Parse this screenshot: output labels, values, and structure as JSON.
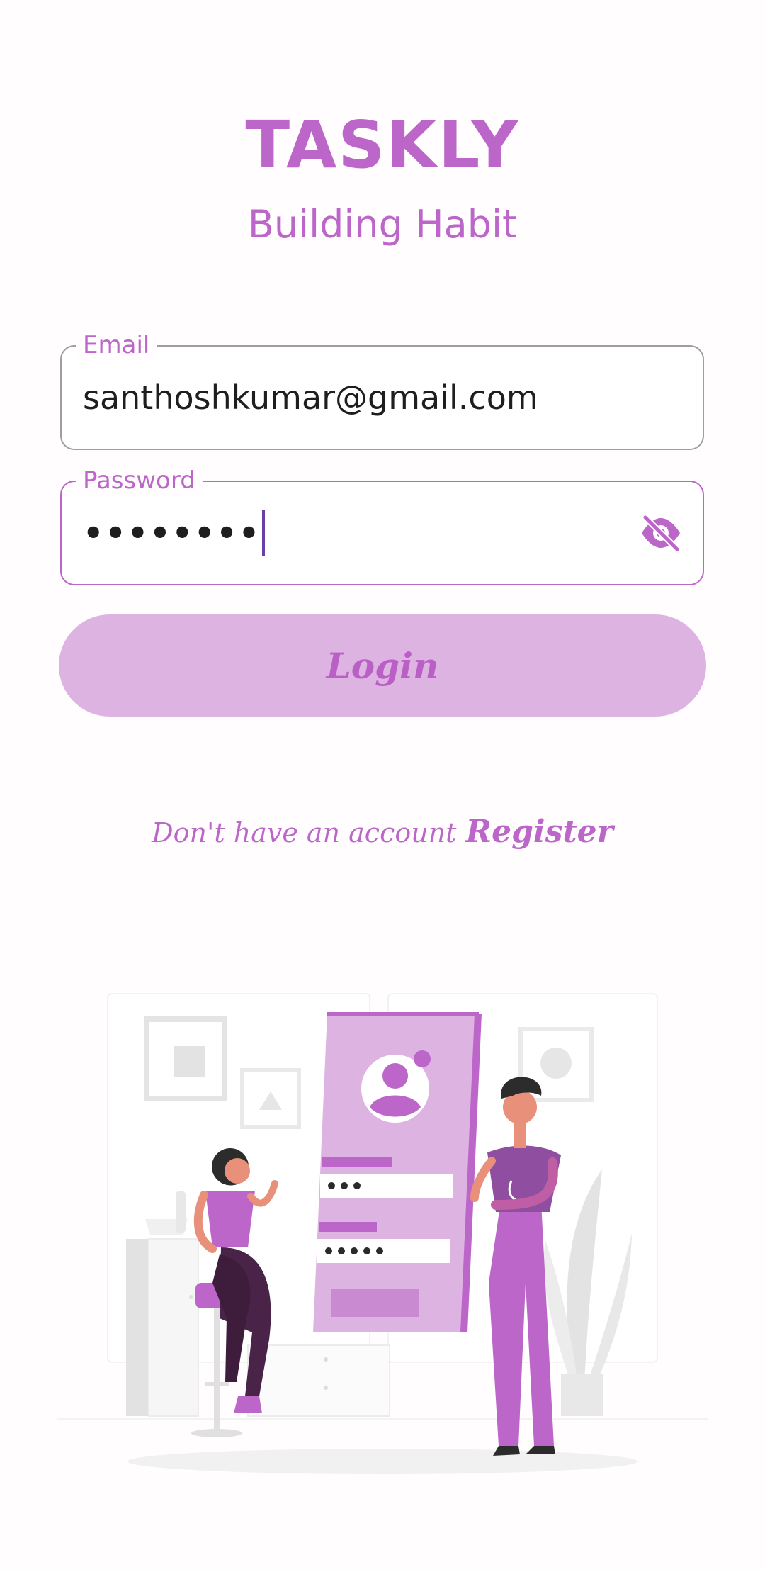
{
  "app": {
    "title": "TASKLY",
    "subtitle": "Building Habit"
  },
  "form": {
    "email": {
      "label": "Email",
      "value": "santhoshkumar@gmail.com"
    },
    "password": {
      "label": "Password",
      "value_masked": "••••••••",
      "toggle_icon": "visibility-off-icon"
    },
    "login_label": "Login"
  },
  "register": {
    "prompt": "Don't have an account",
    "link_label": "Register"
  },
  "colors": {
    "accent": "#bb66c8",
    "button_bg": "#ddb3e2",
    "dark_purple": "#4a2448",
    "background": "#fffdfe"
  }
}
